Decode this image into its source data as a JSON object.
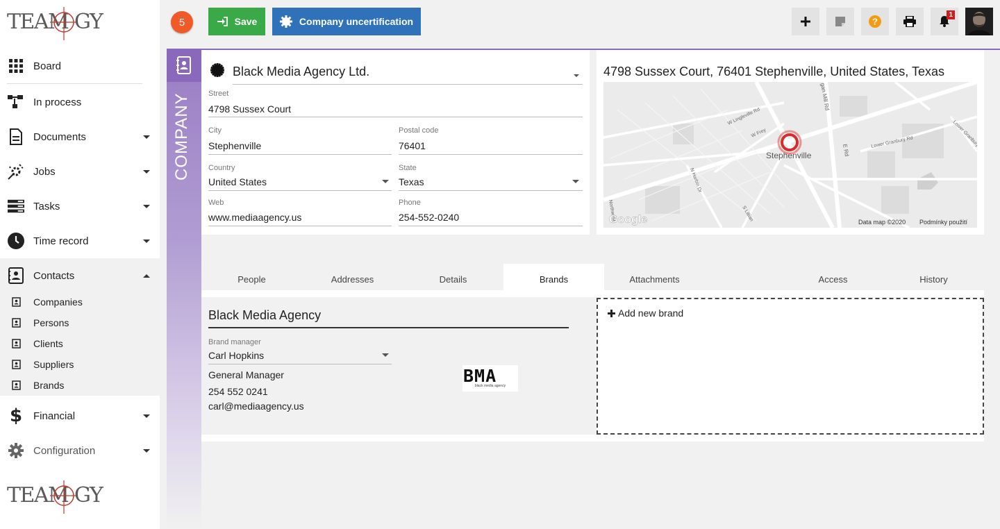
{
  "app": {
    "logo_text": "TEAMOGY"
  },
  "sidebar": {
    "items": [
      {
        "label": "Board",
        "icon": "grid-icon"
      },
      {
        "label": "In process",
        "icon": "flow-icon"
      },
      {
        "label": "Documents",
        "icon": "document-icon"
      },
      {
        "label": "Jobs",
        "icon": "jobs-icon"
      },
      {
        "label": "Tasks",
        "icon": "tasks-icon"
      },
      {
        "label": "Time record",
        "icon": "clock-icon"
      },
      {
        "label": "Contacts",
        "icon": "contacts-icon"
      },
      {
        "label": "Financial",
        "icon": "dollar-icon"
      },
      {
        "label": "Configuration",
        "icon": "gear-icon"
      }
    ],
    "contacts_sub": [
      {
        "label": "Companies"
      },
      {
        "label": "Persons"
      },
      {
        "label": "Clients"
      },
      {
        "label": "Suppliers"
      },
      {
        "label": "Brands"
      }
    ]
  },
  "toolbar": {
    "badge_count": "5",
    "save_label": "Save",
    "uncert_label": "Company uncertification",
    "notification_count": "1"
  },
  "company": {
    "section_label": "COMPANY",
    "name": "Black Media Agency Ltd.",
    "street_label": "Street",
    "street": "4798  Sussex Court",
    "city_label": "City",
    "city": "Stephenville",
    "postal_label": "Postal code",
    "postal": "76401",
    "country_label": "Country",
    "country": "United States",
    "state_label": "State",
    "state": "Texas",
    "web_label": "Web",
    "web": "www.mediaagency.us",
    "phone_label": "Phone",
    "phone": "254-552-0240"
  },
  "map": {
    "address": "4798 Sussex Court, 76401 Stephenville, United States, Texas",
    "place_label": "Stephenville",
    "roads": [
      "W Lingleville Rd",
      "W Frey",
      "Lower Granbury Rd",
      "Lower Granbury",
      "gan Mill Rd",
      "E Rd",
      "N Harbin Dr",
      "S Lillian",
      "Northwest"
    ],
    "google": "Google",
    "map_data": "Data map ©2020",
    "terms": "Podmínky použití"
  },
  "tabs": [
    {
      "label": "People"
    },
    {
      "label": "Addresses"
    },
    {
      "label": "Details"
    },
    {
      "label": "Brands",
      "active": true
    },
    {
      "label": "Attachments"
    },
    {
      "label": ""
    },
    {
      "label": "Access"
    },
    {
      "label": "History"
    }
  ],
  "brand": {
    "name": "Black Media Agency",
    "manager_label": "Brand manager",
    "manager": "Carl Hopkins",
    "position": "General Manager",
    "phone": "254 552 0241",
    "email": "carl@mediaagency.us",
    "logo_text": "BMA",
    "logo_subtext": "black media agency"
  },
  "add_brand": {
    "label": "Add new brand"
  }
}
